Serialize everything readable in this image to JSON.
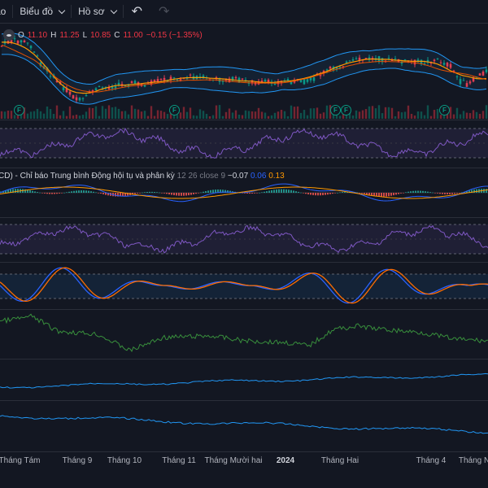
{
  "toolbar": {
    "partial_label": "ảo",
    "chart_menu_label": "Biểu đồ",
    "profile_menu_label": "Hồ sơ",
    "undo_icon": "undo-icon",
    "redo_icon": "redo-icon"
  },
  "price_legend": {
    "o_label": "O",
    "o_value": "11.10",
    "h_label": "H",
    "h_value": "11.25",
    "l_label": "L",
    "l_value": "10.85",
    "c_label": "C",
    "c_value": "11.00",
    "change": "−0.15 (−1.35%)"
  },
  "macd_legend": {
    "title": "CD) - Chỉ báo Trung bình Động hội tụ và phân kỳ",
    "params": "12 26 close 9",
    "v1": "−0.07",
    "v2": "0.06",
    "v3": "0.13"
  },
  "dividend_badge": "F",
  "time_axis": [
    "Tháng Tám",
    "Tháng 9",
    "Tháng 10",
    "Tháng 11",
    "Tháng Mười hai",
    "2024",
    "Tháng Hai",
    "Tháng 4",
    "Tháng Năm"
  ],
  "colors": {
    "background": "#131722",
    "up": "#089981",
    "down": "#f23645",
    "bb_band": "#2962ff",
    "rsi_line": "#7e57c2",
    "stoch_k": "#2962ff",
    "stoch_d": "#ff6d00",
    "green_line": "#388e3c",
    "blue_line": "#2196f3",
    "ma_orange": "#ff9800"
  }
}
